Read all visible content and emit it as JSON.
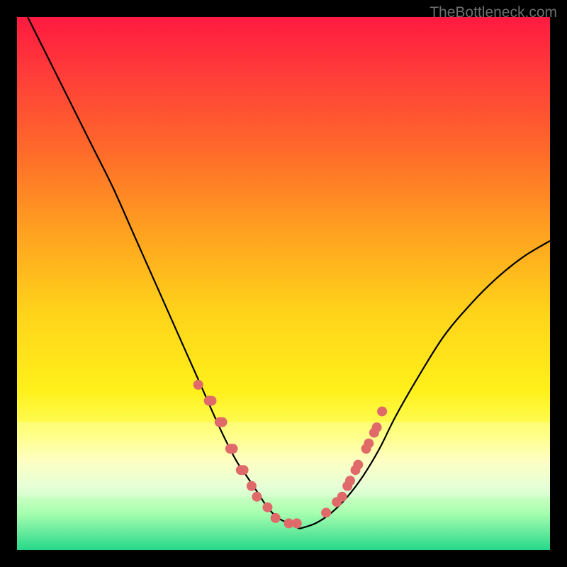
{
  "watermark": "TheBottleneck.com",
  "chart_data": {
    "type": "line",
    "title": "",
    "xlabel": "",
    "ylabel": "",
    "xlim": [
      0,
      100
    ],
    "ylim": [
      0,
      100
    ],
    "series": [
      {
        "name": "left-curve",
        "x": [
          2,
          6,
          10,
          14,
          18,
          22,
          26,
          30,
          34,
          38,
          41,
          43,
          45,
          47,
          49,
          51,
          53
        ],
        "y": [
          100,
          92,
          84,
          76,
          68,
          59,
          50,
          41,
          32,
          23,
          17,
          14,
          11,
          8,
          6,
          5,
          4
        ]
      },
      {
        "name": "right-curve",
        "x": [
          53,
          56,
          59,
          62,
          65,
          68,
          71,
          75,
          80,
          85,
          90,
          95,
          100
        ],
        "y": [
          4,
          5,
          7,
          10,
          14,
          19,
          25,
          32,
          40,
          46,
          51,
          55,
          58
        ]
      },
      {
        "name": "left-dot-cluster",
        "x": [
          34,
          36,
          36.5,
          38,
          38.5,
          40,
          40.5,
          42,
          42.5,
          44,
          45,
          47,
          48.5,
          51,
          52.5
        ],
        "y": [
          31,
          28,
          28,
          24,
          24,
          19,
          19,
          15,
          15,
          12,
          10,
          8,
          6,
          5,
          5
        ]
      },
      {
        "name": "right-dot-cluster",
        "x": [
          58,
          60,
          61,
          62,
          62.5,
          63.5,
          64,
          65.5,
          66,
          67,
          67.5,
          68.5
        ],
        "y": [
          7,
          9,
          10,
          12,
          13,
          15,
          16,
          19,
          20,
          22,
          23,
          26
        ]
      }
    ],
    "gradient_stops": [
      {
        "offset": 0.0,
        "color": "#ff1a40"
      },
      {
        "offset": 0.1,
        "color": "#ff3a3a"
      },
      {
        "offset": 0.25,
        "color": "#ff6a2a"
      },
      {
        "offset": 0.4,
        "color": "#ffa020"
      },
      {
        "offset": 0.55,
        "color": "#ffd21a"
      },
      {
        "offset": 0.7,
        "color": "#fff01a"
      },
      {
        "offset": 0.78,
        "color": "#ffff60"
      },
      {
        "offset": 0.83,
        "color": "#ffffb0"
      },
      {
        "offset": 0.88,
        "color": "#e0ffcc"
      },
      {
        "offset": 0.93,
        "color": "#a8ffb0"
      },
      {
        "offset": 0.97,
        "color": "#60e89a"
      },
      {
        "offset": 1.0,
        "color": "#25d88a"
      }
    ],
    "light_band": {
      "y0": 0.76,
      "y1": 0.9,
      "color": "#ffffff",
      "alpha": 0.22
    },
    "curve_color": "#000000",
    "curve_width": 2.2,
    "dot_fill": "#e06a6a",
    "dot_radius": 7
  }
}
